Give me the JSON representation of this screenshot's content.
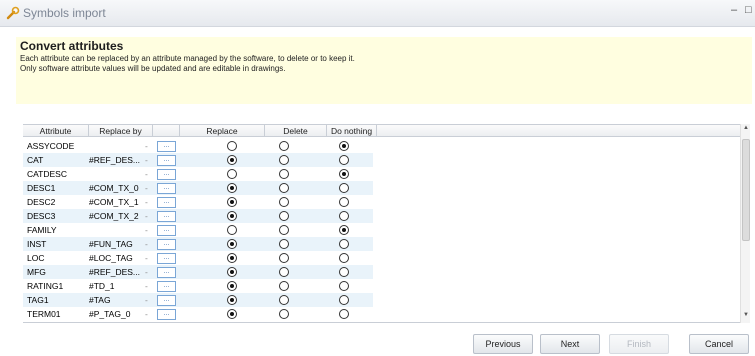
{
  "window": {
    "title": "Symbols import",
    "minimize_glyph": "–",
    "maximize_glyph": "□",
    "icon": "wrench-icon"
  },
  "header": {
    "title": "Convert attributes",
    "line1": "Each attribute can be replaced by an attribute managed by the software, to delete or to keep it.",
    "line2": "Only software attribute values will be updated and are editable in drawings."
  },
  "grid": {
    "columns": {
      "attribute": "Attribute",
      "replace_by": "Replace by",
      "replace": "Replace",
      "delete": "Delete",
      "do_nothing": "Do nothing"
    },
    "browse_label": "...",
    "dropdown_glyph": "-",
    "rows": [
      {
        "attribute": "ASSYCODE",
        "replace_by": "",
        "choice": "nothing"
      },
      {
        "attribute": "CAT",
        "replace_by": "#REF_DES...",
        "choice": "replace"
      },
      {
        "attribute": "CATDESC",
        "replace_by": "",
        "choice": "nothing"
      },
      {
        "attribute": "DESC1",
        "replace_by": "#COM_TX_0",
        "choice": "replace"
      },
      {
        "attribute": "DESC2",
        "replace_by": "#COM_TX_1",
        "choice": "replace"
      },
      {
        "attribute": "DESC3",
        "replace_by": "#COM_TX_2",
        "choice": "replace"
      },
      {
        "attribute": "FAMILY",
        "replace_by": "",
        "choice": "nothing"
      },
      {
        "attribute": "INST",
        "replace_by": "#FUN_TAG",
        "choice": "replace"
      },
      {
        "attribute": "LOC",
        "replace_by": "#LOC_TAG",
        "choice": "replace"
      },
      {
        "attribute": "MFG",
        "replace_by": "#REF_DES...",
        "choice": "replace"
      },
      {
        "attribute": "RATING1",
        "replace_by": "#TD_1",
        "choice": "replace"
      },
      {
        "attribute": "TAG1",
        "replace_by": "#TAG",
        "choice": "replace"
      },
      {
        "attribute": "TERM01",
        "replace_by": "#P_TAG_0",
        "choice": "replace"
      }
    ]
  },
  "scrollbar": {
    "up_glyph": "▲",
    "down_glyph": "▼"
  },
  "footer": {
    "previous_label": "Previous",
    "next_label": "Next",
    "finish_label": "Finish",
    "cancel_label": "Cancel"
  }
}
